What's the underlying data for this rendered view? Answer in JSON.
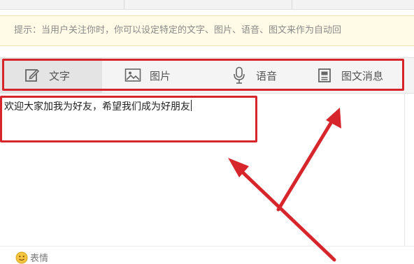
{
  "tip": {
    "text": "提示：当用户关注你时，你可以设定特定的文字、图片、语音、图文来作为自动回"
  },
  "toolbar": {
    "tabs": [
      {
        "label": "文字",
        "icon": "edit-icon",
        "active": true
      },
      {
        "label": "图片",
        "icon": "image-icon",
        "active": false
      },
      {
        "label": "语音",
        "icon": "microphone-icon",
        "active": false
      },
      {
        "label": "图文消息",
        "icon": "article-icon",
        "active": false
      }
    ]
  },
  "editor": {
    "value": "欢迎大家加我为好友，希望我们成为好朋友"
  },
  "bottom": {
    "emoji_label": "表情",
    "emoji_icon": "smiley-icon"
  },
  "colors": {
    "highlight": "#d6262c",
    "tip_background": "#fffbe6"
  }
}
